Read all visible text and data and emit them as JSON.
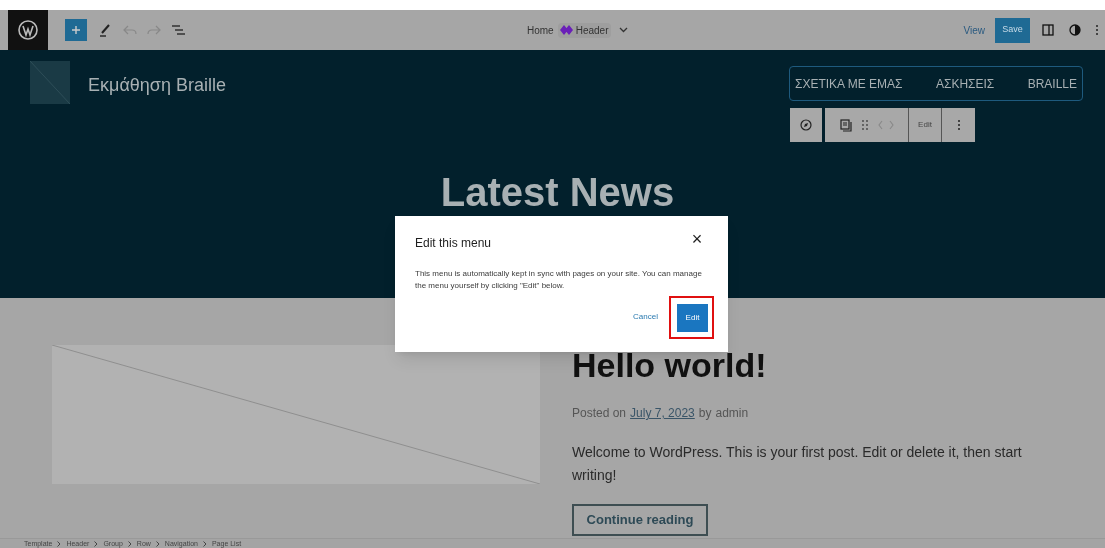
{
  "toolbar": {
    "breadcrumb_page": "Home",
    "breadcrumb_template": "Header",
    "view": "View",
    "save": "Save"
  },
  "header": {
    "site_title": "Εκμάθηση Braille",
    "nav_items": [
      "ΣΧΕΤΙΚΑ ΜΕ ΕΜΑΣ",
      "ΑΣΚΗΣΕΙΣ",
      "BRAILLE"
    ],
    "block_toolbar_edit": "Edit",
    "heading": "Latest News"
  },
  "dialog": {
    "title": "Edit this menu",
    "close": "×",
    "message": "This menu is automatically kept in sync with pages on your site. You can manage the menu yourself by clicking \"Edit\" below.",
    "cancel": "Cancel",
    "confirm": "Edit"
  },
  "post": {
    "title": "Hello world!",
    "posted_on": "Posted on",
    "date": "July 7, 2023",
    "by": "by",
    "author": "admin",
    "excerpt": "Welcome to WordPress. This is your first post. Edit or delete it, then start writing!",
    "continue": "Continue reading"
  },
  "breadcrumbs": [
    "Template",
    "Header",
    "Group",
    "Row",
    "Navigation",
    "Page List"
  ]
}
